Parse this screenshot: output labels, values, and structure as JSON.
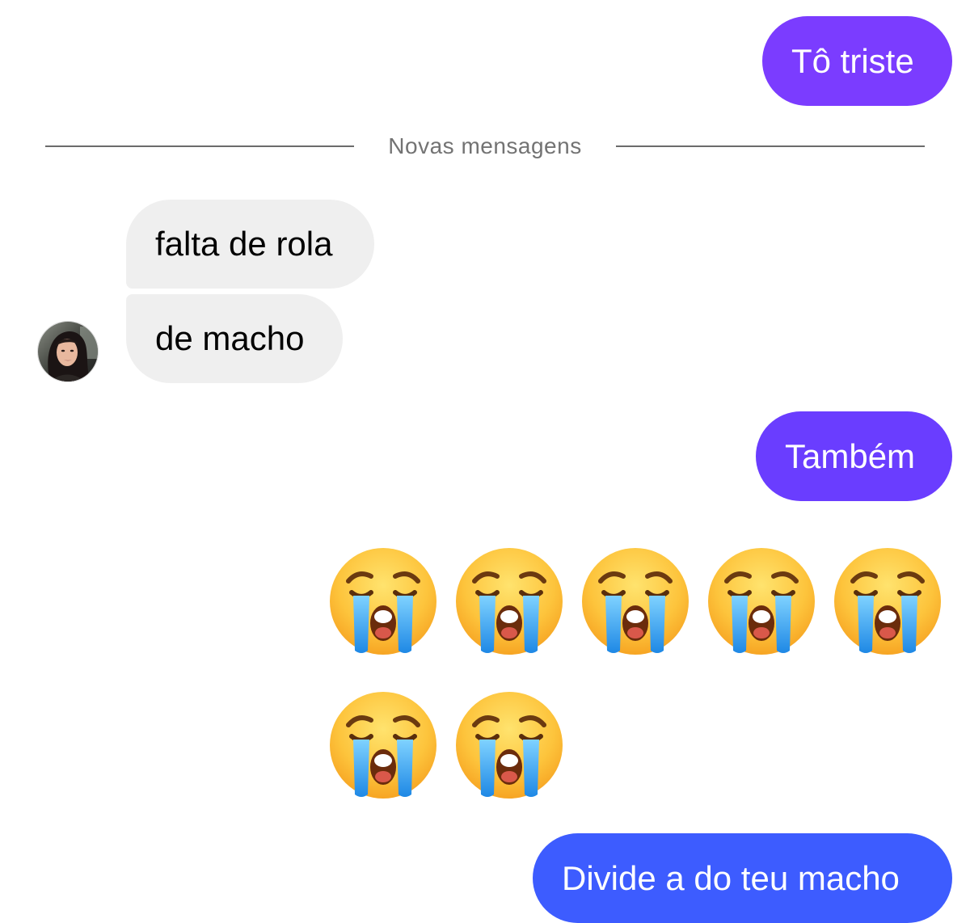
{
  "conversation": {
    "divider_label": "Novas mensagens",
    "contact": {
      "avatar_icon": "contact-avatar-photo"
    },
    "messages": [
      {
        "id": "msg-1",
        "direction": "outgoing",
        "text": "Tô triste",
        "color": "#7b3cff"
      },
      {
        "id": "msg-2",
        "direction": "incoming",
        "text": "falta de rola",
        "color": "#efefef"
      },
      {
        "id": "msg-3",
        "direction": "incoming",
        "text": "de macho",
        "color": "#efefef"
      },
      {
        "id": "msg-4",
        "direction": "outgoing",
        "text": "Também",
        "color": "#6a3dff"
      },
      {
        "id": "msg-5",
        "direction": "outgoing",
        "type": "emoji",
        "emoji_icon": "loudly-crying-face-icon",
        "count": 7
      },
      {
        "id": "msg-6",
        "direction": "outgoing",
        "text": "Divide a do teu macho",
        "color": "#3d5cff"
      }
    ]
  }
}
